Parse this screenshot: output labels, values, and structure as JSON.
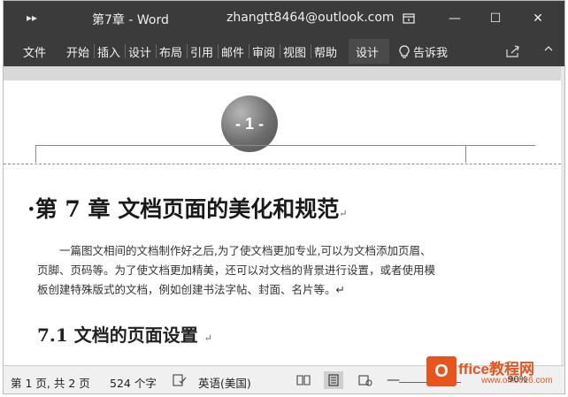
{
  "titlebar": {
    "quick_access": "▸▸",
    "title": "第7章 - Word",
    "account": "zhangtt8464@outlook.com",
    "ribbon_options_icon": "ribbon-display-icon",
    "minimize": "—",
    "maximize": "☐",
    "close": "✕"
  },
  "ribbon": {
    "tabs": [
      "文件",
      "开始",
      "插入",
      "设计",
      "布局",
      "引用",
      "邮件",
      "审阅",
      "视图",
      "帮助",
      "设计"
    ],
    "tell_me": "告诉我",
    "share_icon": "share-icon"
  },
  "document": {
    "page_number_badge": "- 1 -",
    "chapter_title": "·第 7 章  文档页面的美化和规范",
    "para_mark": "↵",
    "paragraph_lines": [
      "一篇图文相间的文档制作好之后,为了使文档更加专业,可以为文档添加页眉、",
      "页脚、页码等。为了使文档更加精美，还可以对文档的背景进行设置，或者使用模",
      "板创建特殊版式的文档，例如创建书法字帖、封面、名片等。↵"
    ],
    "section_title": "7.1  文档的页面设置"
  },
  "statusbar": {
    "page_info": "第 1 页, 共 2 页",
    "word_count": "524 个字",
    "language": "英语(美国)",
    "zoom_minus": "—",
    "zoom_level": "90%"
  },
  "watermark": {
    "box_letter": "O",
    "brand": "ffice教程网",
    "sub": "www.office26.com"
  },
  "colors": {
    "titlebar_bg": "#3b3b3b",
    "accent_logo": "#e8541e"
  }
}
